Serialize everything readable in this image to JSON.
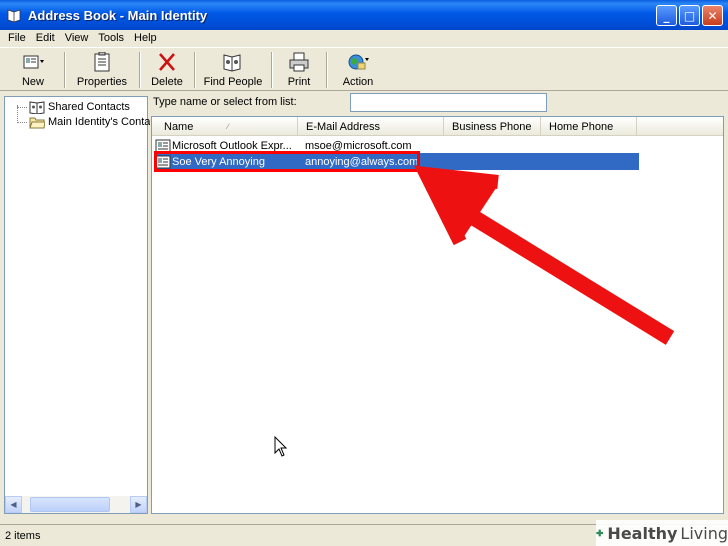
{
  "window": {
    "title": "Address Book - Main Identity"
  },
  "menubar": {
    "items": [
      "File",
      "Edit",
      "View",
      "Tools",
      "Help"
    ]
  },
  "toolbar": {
    "new_label": "New",
    "properties_label": "Properties",
    "delete_label": "Delete",
    "find_people_label": "Find People",
    "print_label": "Print",
    "action_label": "Action"
  },
  "tree": {
    "items": [
      {
        "label": "Shared Contacts",
        "icon": "address-book-icon"
      },
      {
        "label": "Main Identity's Conta",
        "icon": "folder-icon"
      }
    ]
  },
  "search": {
    "label": "Type name or select from list:",
    "value": ""
  },
  "list": {
    "columns": [
      "Name",
      "E-Mail Address",
      "Business Phone",
      "Home Phone"
    ],
    "sort_column": "Name",
    "rows": [
      {
        "name": "Microsoft Outlook Expr...",
        "email": "msoe@microsoft.com",
        "selected": false
      },
      {
        "name": "Soe Very Annoying",
        "email": "annoying@always.com",
        "selected": true
      }
    ]
  },
  "statusbar": {
    "text": "2 items"
  },
  "watermark": {
    "bold": "Healthy",
    "light": "Living"
  },
  "colors": {
    "selection": "#316ac5",
    "annotation": "#ff0000",
    "titlebar": "#0058e6"
  }
}
